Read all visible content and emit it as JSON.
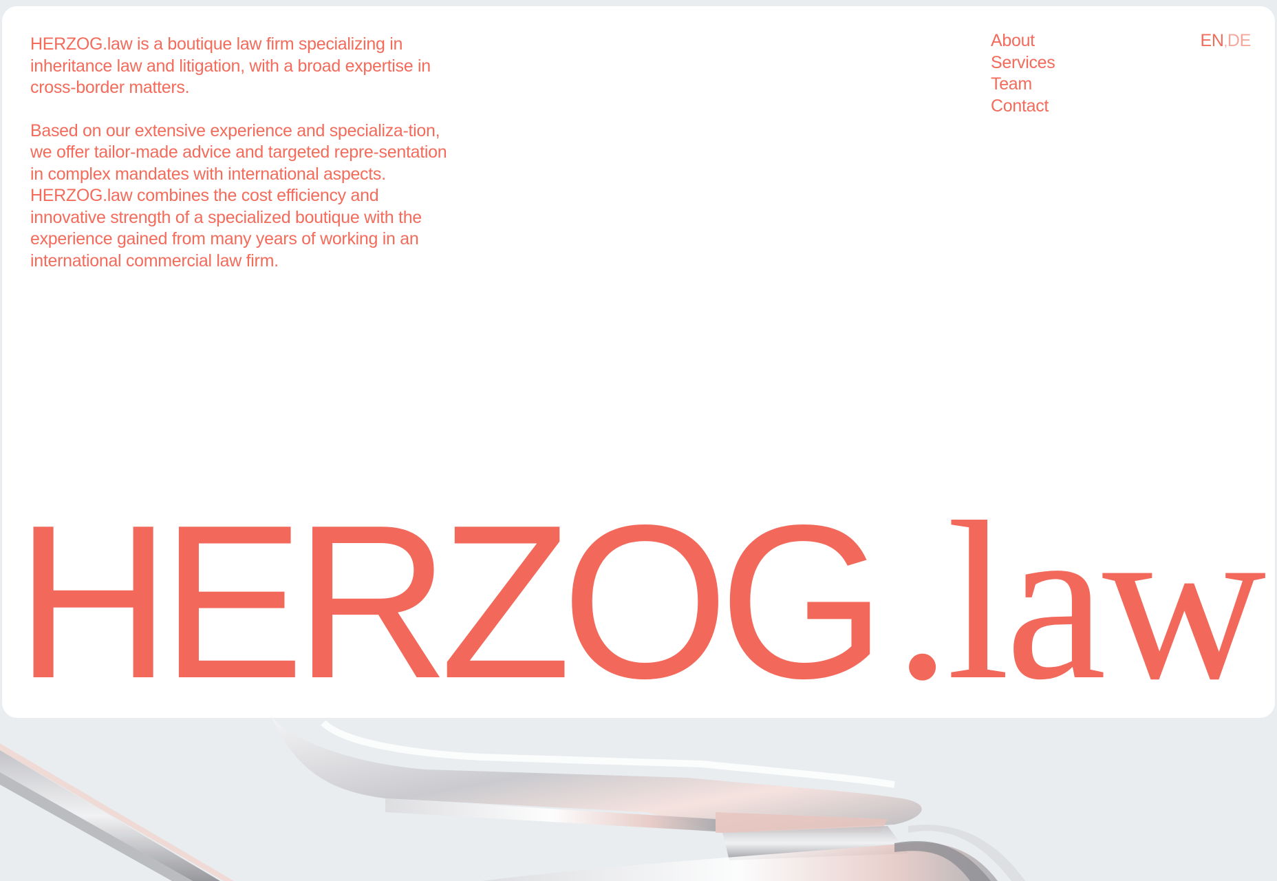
{
  "intro": {
    "paragraph_1": "HERZOG.law is a boutique law firm specializing in inheritance law and litigation, with a broad expertise in cross-border matters.",
    "paragraph_2": "Based on our extensive experience and specializa-tion, we offer tailor-made advice and targeted repre-sentation in complex mandates with international aspects. HERZOG.law combines the cost efficiency and innovative strength of a specialized boutique with the experience gained from many years of working in an international commercial law firm."
  },
  "nav": {
    "items": [
      {
        "label": "About"
      },
      {
        "label": "Services"
      },
      {
        "label": "Team"
      },
      {
        "label": "Contact"
      }
    ]
  },
  "language": {
    "en": "EN",
    "separator": ",",
    "de": "DE"
  },
  "wordmark": {
    "primary": "HERZOG",
    "secondary": ".law"
  },
  "colors": {
    "accent": "#f26b5b",
    "accent_light": "#f5a79c",
    "background": "#e9edf0",
    "card": "#ffffff"
  }
}
